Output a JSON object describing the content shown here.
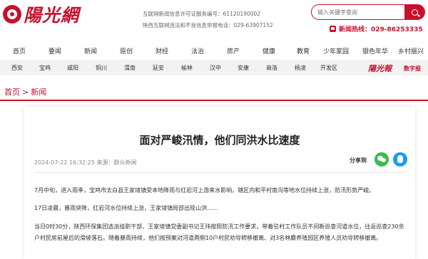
{
  "header": {
    "logo_text": "陽光網",
    "license_line1": "互联网新闻信息许可证服务编号：61120190002",
    "license_line2": "陕西互联网违法和不良信息举报电话：029-63907152",
    "search_placeholder": "输入关键字查询",
    "hotline": "新闻热线：029-86253335"
  },
  "nav": {
    "main": [
      "首页",
      "要闻",
      "新闻",
      "原创",
      "财经",
      "法治",
      "房产",
      "健康",
      "教育",
      "少年家园",
      "银色年华",
      "乡村振兴"
    ],
    "cities": [
      "西安",
      "宝鸡",
      "咸阳",
      "铜川",
      "渭南",
      "延安",
      "榆林",
      "汉中",
      "安康",
      "商洛",
      "杨凌",
      "开发区"
    ],
    "paper_logo": "陽光報",
    "paper_sub": "数字报"
  },
  "breadcrumb": {
    "home": "首页",
    "separator": ">",
    "current": "新闻"
  },
  "article": {
    "title": "面对严峻汛情，他们同洪水比速度",
    "meta": "2024-07-22 16:32:25 来源：群众新闻",
    "share_label": "分享到",
    "paragraphs": [
      "7月中旬，进入雨季，宝鸡市太白县王家堎镇受本地降雨与红岩河上游来水影响，辖区内和平村南沟等地水位持续上涨，防汛形势严峻。",
      "17日凌晨，暴雨突降，红岩河水位持续上涨，王家堎镇局部出现山洪......",
      "当日0时30分，陕西环保集团选派挂职干部、王家堎镇党委副书记王玮按照防汛工作要求，带着驻村工作队员不间断巡查河道水位，往返巡查230余户村民房前屋后的滑坡落石。随着暴雨持续，他们按预案对河道两侧10户村民劝导转移撤离、对3名林麝养殖园区养殖人员劝导转移撤离。"
    ]
  }
}
